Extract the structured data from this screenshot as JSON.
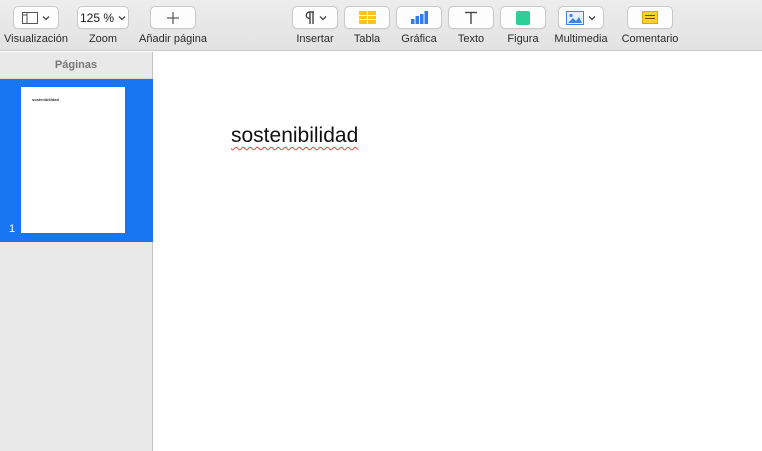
{
  "toolbar": {
    "view": {
      "label": "Visualización",
      "icon": "sidebar-view-icon"
    },
    "zoom": {
      "label": "Zoom",
      "value": "125 %"
    },
    "add_page": {
      "label": "Añadir página",
      "icon": "plus-icon"
    },
    "insert": {
      "label": "Insertar",
      "icon": "pilcrow-icon"
    },
    "table": {
      "label": "Tabla",
      "icon": "table-icon"
    },
    "chart": {
      "label": "Gráfica",
      "icon": "bar-chart-icon"
    },
    "text": {
      "label": "Texto",
      "icon": "text-box-icon"
    },
    "shape": {
      "label": "Figura",
      "icon": "shape-icon"
    },
    "media": {
      "label": "Multimedia",
      "icon": "image-icon"
    },
    "comment": {
      "label": "Comentario",
      "icon": "comment-icon"
    }
  },
  "sidebar": {
    "title": "Páginas",
    "pages": [
      {
        "number": "1",
        "preview_text": "sostenibilidad",
        "selected": true
      }
    ]
  },
  "document": {
    "text": "sostenibilidad"
  },
  "colors": {
    "selection": "#1876f2",
    "table_icon": "#f7c51e",
    "chart_icon": "#2f7be8",
    "shape_icon": "#2ecf96",
    "spellcheck": "#e0433b"
  }
}
